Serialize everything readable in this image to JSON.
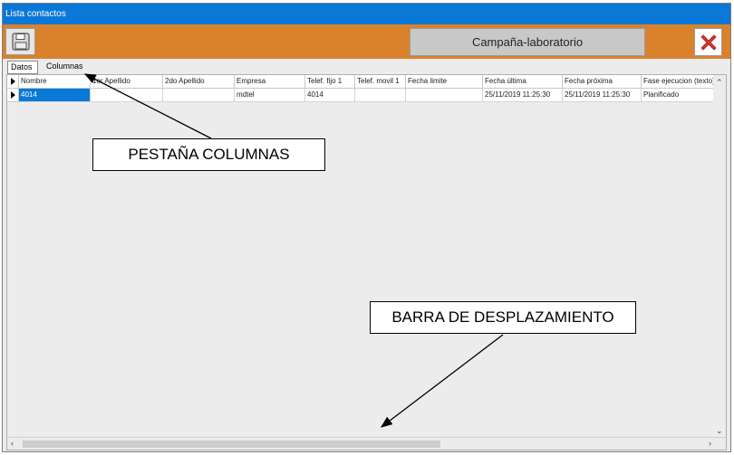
{
  "window": {
    "title": "Lista contactos"
  },
  "toolbar": {
    "save_icon": "floppy-disk-icon",
    "campaign_label": "Campaña-laboratorio",
    "close_icon": "close-icon",
    "close_color": "#d9342b",
    "accent_color": "#d9822b"
  },
  "tabs": [
    {
      "label": "Datos"
    },
    {
      "label": "Columnas"
    }
  ],
  "grid": {
    "columns": [
      "Nombre",
      "1er Apellido",
      "2do Apellido",
      "Empresa",
      "Telef. fijo 1",
      "Telef. movil 1",
      "Fecha limite",
      "Fecha última",
      "Fecha próxima",
      "Fase ejecucion (texto)"
    ],
    "rows": [
      [
        "4014",
        "",
        "",
        "mdtel",
        "4014",
        "",
        "",
        "25/11/2019 11:25:30",
        "25/11/2019 11:25:30",
        "Planificado"
      ]
    ]
  },
  "annotations": {
    "tab_columns": "PESTAÑA COLUMNAS",
    "scrollbar": "BARRA DE DESPLAZAMIENTO"
  }
}
